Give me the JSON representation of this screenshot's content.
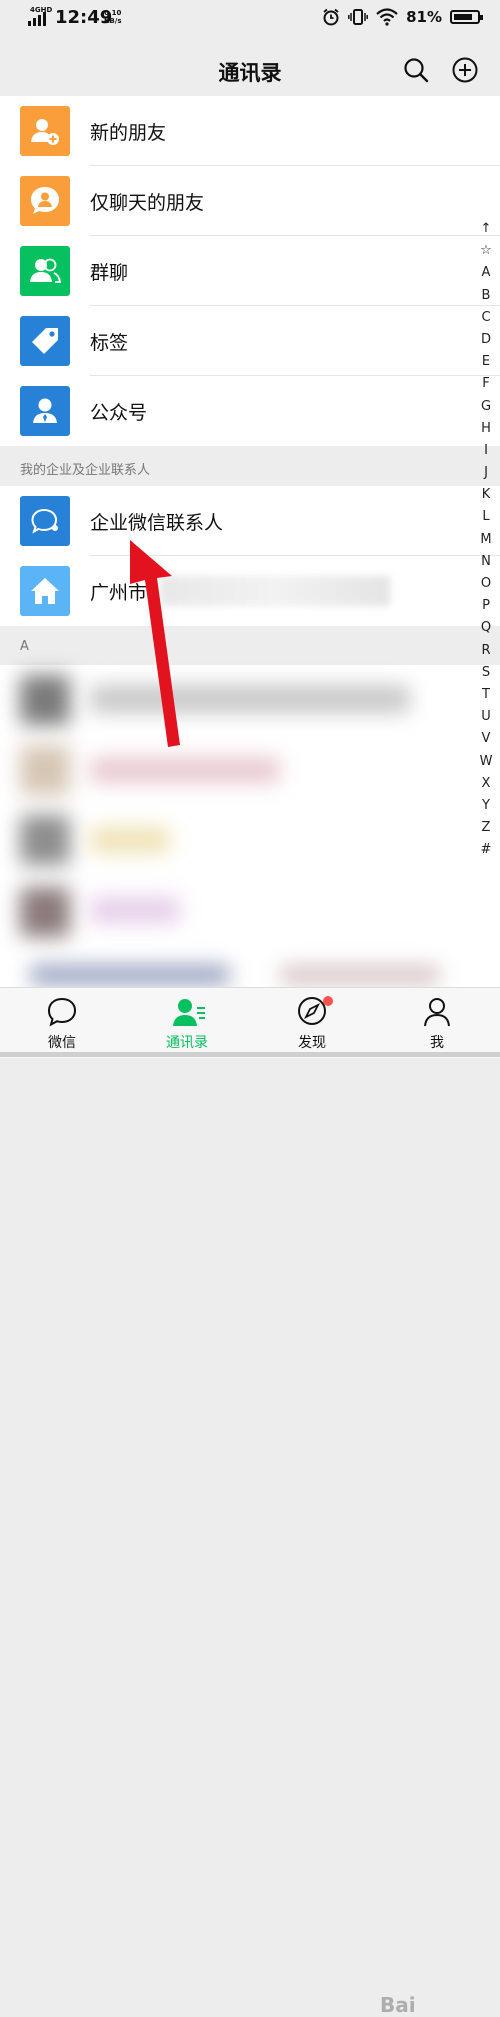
{
  "status": {
    "network": "4GHD",
    "time": "12:49",
    "speed_value": "0.10",
    "speed_unit": "KB/s",
    "battery": "81%",
    "battery_level": 0.81
  },
  "nav": {
    "title": "通讯录",
    "search_icon": "search-icon",
    "add_icon": "plus-circle-icon"
  },
  "menu": [
    {
      "label": "新的朋友",
      "color": "#fa9d3b",
      "icon": "person-add-icon"
    },
    {
      "label": "仅聊天的朋友",
      "color": "#fa9d3b",
      "icon": "chat-person-icon"
    },
    {
      "label": "群聊",
      "color": "#07c160",
      "icon": "group-icon"
    },
    {
      "label": "标签",
      "color": "#2782d7",
      "icon": "tag-icon"
    },
    {
      "label": "公众号",
      "color": "#2782d7",
      "icon": "official-account-icon"
    }
  ],
  "enterprise_section": "我的企业及企业联系人",
  "enterprise": [
    {
      "label": "企业微信联系人",
      "color": "#2782d7",
      "icon": "work-chat-icon"
    },
    {
      "label": "广州市",
      "color": "#5ab4f5",
      "icon": "house-icon"
    }
  ],
  "letter_section": "A",
  "index": [
    "↑",
    "☆",
    "A",
    "B",
    "C",
    "D",
    "E",
    "F",
    "G",
    "H",
    "I",
    "J",
    "K",
    "L",
    "M",
    "N",
    "O",
    "P",
    "Q",
    "R",
    "S",
    "T",
    "U",
    "V",
    "W",
    "X",
    "Y",
    "Z",
    "#"
  ],
  "tabs": [
    {
      "label": "微信",
      "icon": "chat-bubble-icon"
    },
    {
      "label": "通讯录",
      "icon": "contacts-icon"
    },
    {
      "label": "发现",
      "icon": "compass-icon"
    },
    {
      "label": "我",
      "icon": "person-icon"
    }
  ],
  "watermark": "Bai"
}
